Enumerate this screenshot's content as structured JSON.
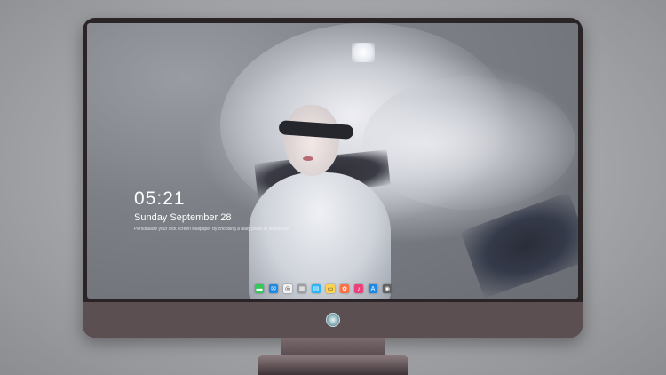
{
  "lock_screen": {
    "time": "05:21",
    "date": "Sunday September  28",
    "caption": "Personalize your lock screen wallpaper by choosing a daily photo or slideshow"
  },
  "dock": {
    "icons": [
      {
        "name": "messages-icon",
        "color": "#34c759",
        "glyph": "▬"
      },
      {
        "name": "mail-icon",
        "color": "#1e88e5",
        "glyph": "✉"
      },
      {
        "name": "safari-icon",
        "color": "#f2f2f2",
        "glyph": "◎"
      },
      {
        "name": "finder-icon",
        "color": "#9e9e9e",
        "glyph": "▦"
      },
      {
        "name": "clapper-icon",
        "color": "#29b6f6",
        "glyph": "▤"
      },
      {
        "name": "notes-icon",
        "color": "#ffd54f",
        "glyph": "▭"
      },
      {
        "name": "photos-icon",
        "color": "#ff7043",
        "glyph": "✿"
      },
      {
        "name": "music-icon",
        "color": "#ec407a",
        "glyph": "♪"
      },
      {
        "name": "app-store-icon",
        "color": "#1e88e5",
        "glyph": "A"
      },
      {
        "name": "camera-icon",
        "color": "#616161",
        "glyph": "◉"
      }
    ]
  },
  "colors": {
    "monitor_frame": "#2a2426",
    "monitor_chin": "#5c4f52"
  }
}
